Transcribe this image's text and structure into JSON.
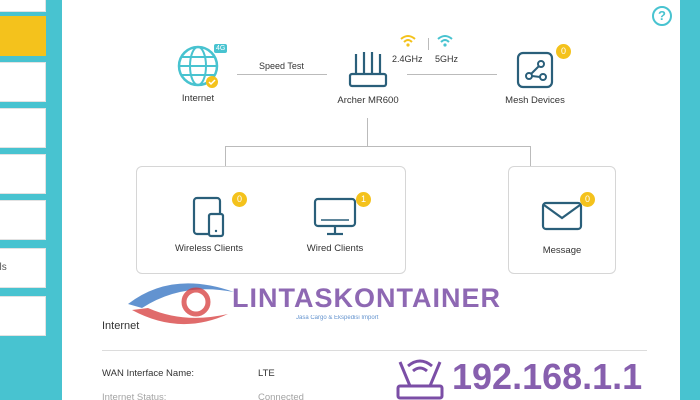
{
  "sidebar": {
    "items": [
      {
        "label": "",
        "active": false
      },
      {
        "label": "",
        "active": true
      },
      {
        "label": "",
        "active": false
      },
      {
        "label": "",
        "active": false
      },
      {
        "label": "",
        "active": false
      },
      {
        "label": "",
        "active": false
      },
      {
        "label": "ols",
        "active": false
      },
      {
        "label": "",
        "active": false
      }
    ]
  },
  "topology": {
    "internet": {
      "label": "Internet",
      "badge": "4G"
    },
    "speed_test": "Speed Test",
    "router": {
      "label": "Archer MR600",
      "band1": "2.4GHz",
      "band2": "5GHz"
    },
    "mesh": {
      "label": "Mesh Devices",
      "count": "0"
    },
    "wireless_clients": {
      "label": "Wireless Clients",
      "count": "0"
    },
    "wired_clients": {
      "label": "Wired Clients",
      "count": "1"
    },
    "message": {
      "label": "Message",
      "count": "0"
    }
  },
  "internet_section": {
    "title": "Internet",
    "rows": [
      {
        "label": "WAN Interface Name:",
        "value": "LTE"
      },
      {
        "label": "Internet Status:",
        "value": "Connected"
      }
    ]
  },
  "watermark": {
    "brand": "LINTASKONTAINER",
    "tagline": "Jasa Cargo & Ekspedisi Import",
    "ip": "192.168.1.1"
  },
  "colors": {
    "accent": "#48c3d0",
    "active": "#f4c21c",
    "watermark": "#7b4ea6"
  }
}
